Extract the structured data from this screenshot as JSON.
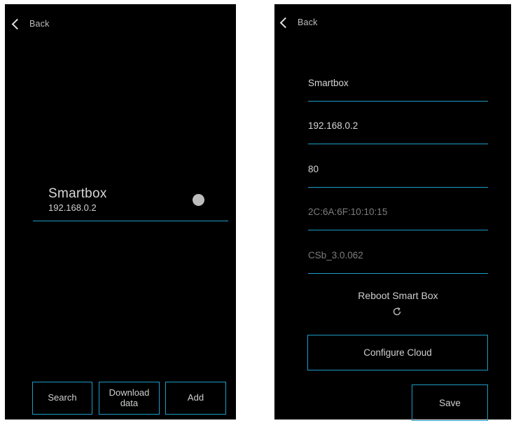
{
  "left_screen": {
    "back_label": "Back",
    "device": {
      "name": "Smartbox",
      "ip": "192.168.0.2",
      "status_color": "#bdbdbd"
    },
    "buttons": {
      "search": "Search",
      "download_line1": "Download",
      "download_line2": "data",
      "add": "Add"
    }
  },
  "right_screen": {
    "back_label": "Back",
    "fields": {
      "name": "Smartbox",
      "ip": "192.168.0.2",
      "port": "80",
      "mac": "2C:6A:6F:10:10:15",
      "version": "CSb_3.0.062"
    },
    "reboot_label": "Reboot Smart Box",
    "configure_cloud_label": "Configure Cloud",
    "save_label": "Save"
  },
  "colors": {
    "background": "#000000",
    "accent": "#1d9cc6",
    "text": "#d6d6d6",
    "muted_text": "#7d7d7d"
  },
  "icons": {
    "back": "chevron-left-icon",
    "reboot": "refresh-icon",
    "status": "status-dot"
  }
}
